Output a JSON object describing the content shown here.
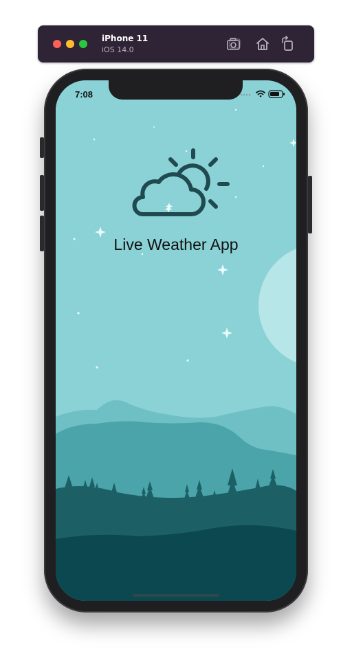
{
  "simulator": {
    "device_name": "iPhone 11",
    "os_version": "iOS 14.0",
    "buttons": [
      {
        "icon": "screenshot-icon"
      },
      {
        "icon": "home-icon"
      },
      {
        "icon": "rotate-icon"
      }
    ]
  },
  "status_bar": {
    "time": "7:08",
    "icons": [
      "cellular-dots-icon",
      "wifi-icon",
      "battery-icon"
    ]
  },
  "app": {
    "title": "Live Weather App",
    "logo_icon": "partly-cloudy-icon"
  },
  "colors": {
    "sky": "#8ad2d6",
    "moon": "#b6e6e8",
    "mountain_far": "#6fc0c4",
    "mountain_mid": "#4aa4a9",
    "trees": "#1c6066",
    "ground": "#0c4850",
    "icon_stroke": "#1f4a50"
  }
}
